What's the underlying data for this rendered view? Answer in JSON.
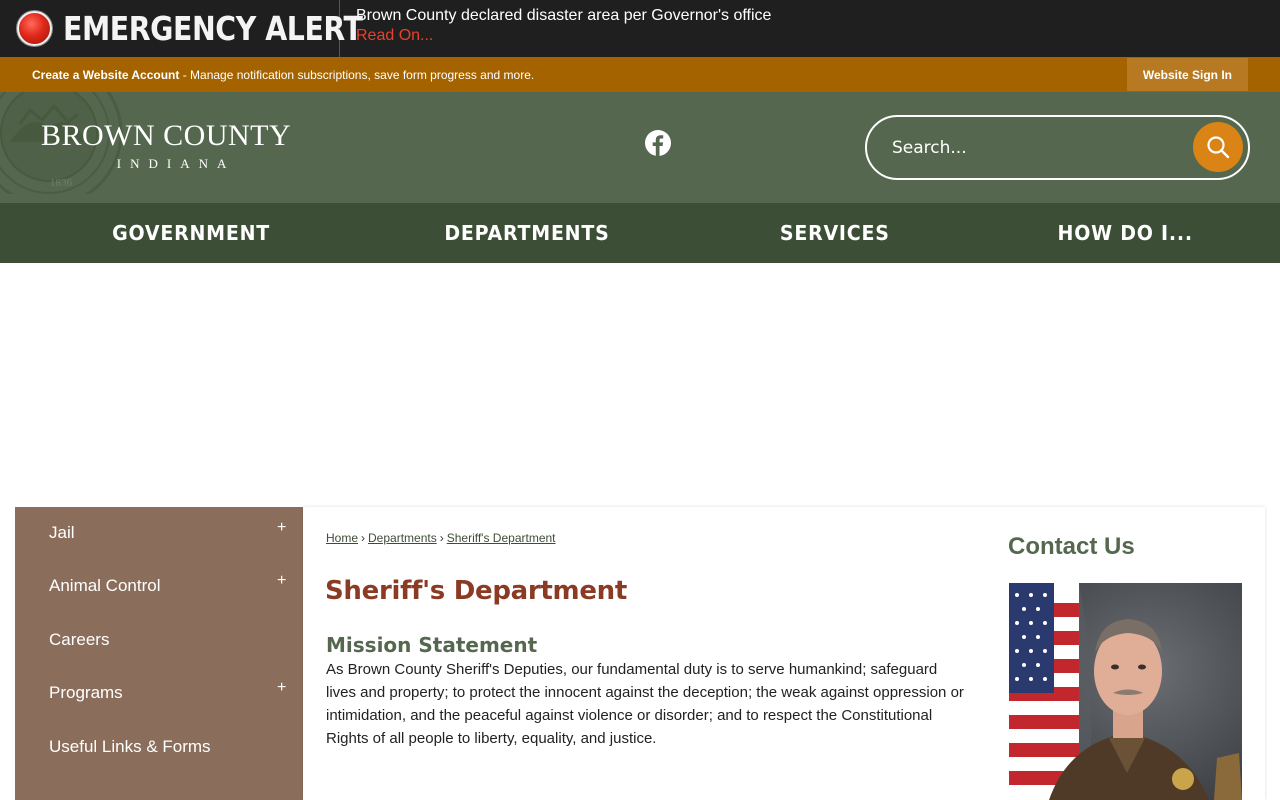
{
  "alert": {
    "title": "EMERGENCY ALERT",
    "message": "Brown County declared disaster area per Governor's office",
    "link": "Read On..."
  },
  "account_bar": {
    "create_link": "Create a Website Account",
    "description": " - Manage notification subscriptions, save form progress and more.",
    "sign_in": "Website Sign In"
  },
  "header": {
    "logo_name": "BROWN COUNTY",
    "logo_state": "INDIANA",
    "seal_year": "1836",
    "search_placeholder": "Search..."
  },
  "nav": {
    "items": [
      "GOVERNMENT",
      "DEPARTMENTS",
      "SERVICES",
      "HOW DO I..."
    ]
  },
  "sidebar": {
    "items": [
      {
        "label": "Jail",
        "expand": "+"
      },
      {
        "label": "Animal Control",
        "expand": "+"
      },
      {
        "label": "Careers",
        "expand": ""
      },
      {
        "label": "Programs",
        "expand": "+"
      },
      {
        "label": "Useful Links & Forms",
        "expand": ""
      }
    ]
  },
  "breadcrumb": [
    "Home",
    "Departments",
    "Sheriff's Department"
  ],
  "breadcrumb_separator": "›",
  "main": {
    "title": "Sheriff's Department",
    "section_title": "Mission Statement",
    "mission_text": "As Brown County Sheriff's Deputies, our fundamental duty is to serve humankind; safeguard lives and property; to protect the innocent against the deception; the weak against oppression or intimidation, and the peaceful against violence or disorder; and to respect the Constitutional Rights of all people to liberty, equality, and justice."
  },
  "contact": {
    "title": "Contact Us"
  },
  "colors": {
    "alert_bg": "#1f1f1f",
    "account_bar": "#a56300",
    "header_green": "#55684f",
    "nav_green": "#3d4e37",
    "sidebar_brown": "#8b6d5b",
    "title_red": "#8b3a24",
    "search_orange": "#d98414"
  },
  "icons": [
    "alert-beacon-icon",
    "facebook-icon",
    "search-icon",
    "plus-icon"
  ]
}
